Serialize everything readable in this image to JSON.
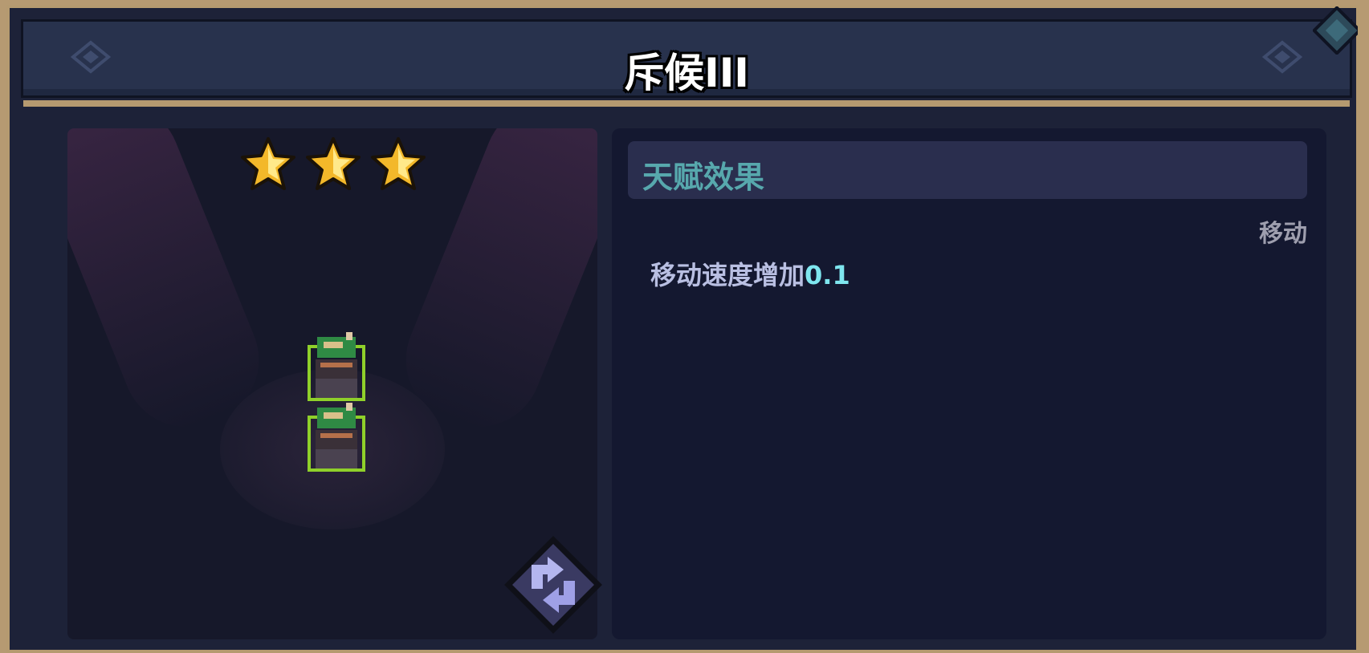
{
  "title": "斥候III",
  "rating": {
    "stars": 3,
    "max": 3
  },
  "talent": {
    "section_title": "天赋效果",
    "tag": "移动",
    "effect_text": "移动速度增加",
    "effect_value": "0.1"
  },
  "colors": {
    "frame": "#b59a70",
    "panel": "#1d2238",
    "title_text": "#ffffff",
    "section_title": "#57a8ad",
    "effect_text": "#b9bfe2",
    "effect_value": "#7fe6ef",
    "star_fill": "#f3b82a",
    "unit_outline": "#8fd02a",
    "swap_button": "#9fa0e6"
  },
  "icons": {
    "star": "star-icon",
    "unit": "scout-unit-sprite",
    "swap": "swap-arrows-icon",
    "deco": "diamond-ornament-icon",
    "corner": "corner-gem-icon"
  }
}
